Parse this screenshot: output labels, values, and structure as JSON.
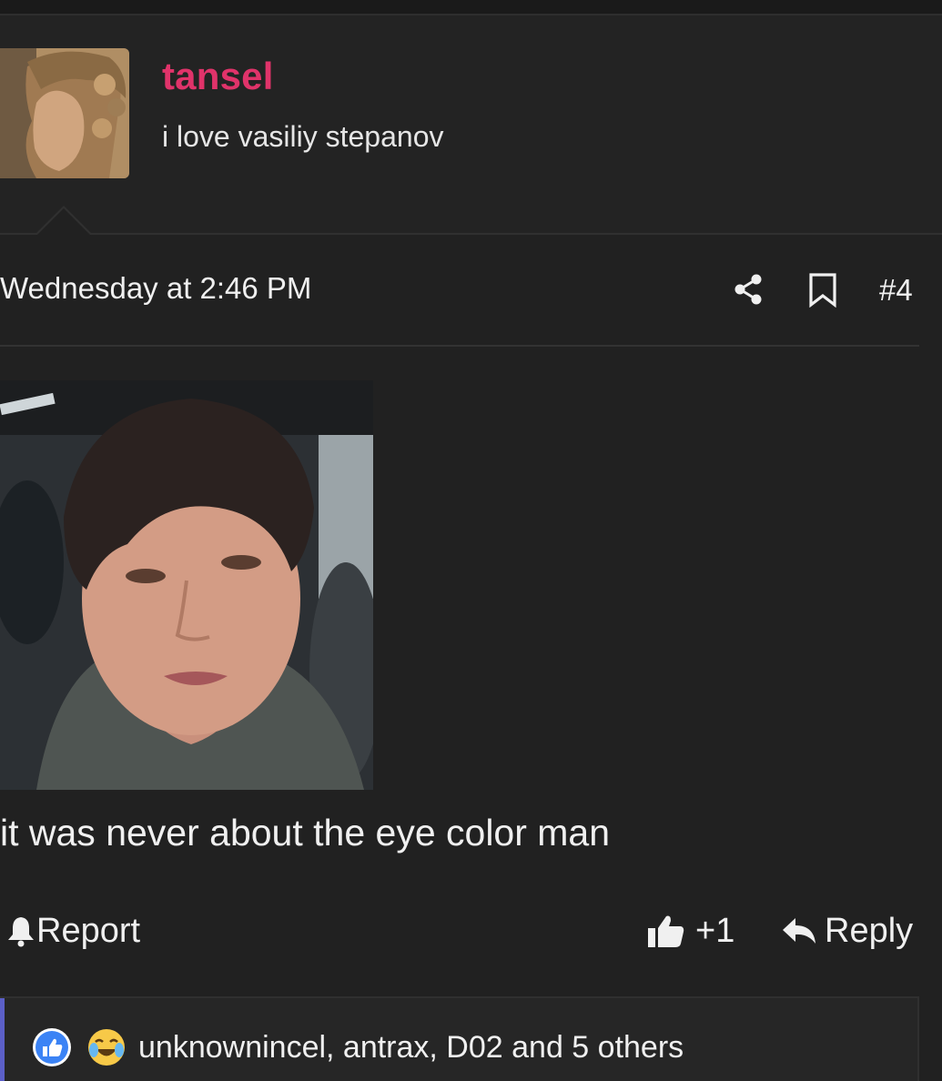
{
  "user": {
    "name": "tansel",
    "title": "i love vasiliy stepanov"
  },
  "post": {
    "date": "Wednesday at 2:46 PM",
    "number": "#4",
    "text": "it was never about the eye color man"
  },
  "actions": {
    "report_label": "Report",
    "like_label": "+1",
    "reply_label": "Reply"
  },
  "reactions": {
    "summary": "unknownincel, antrax, D02 and 5 others"
  },
  "colors": {
    "username": "#e0336a",
    "accent": "#5b5fc7",
    "background": "#212121"
  },
  "icons": [
    "share-icon",
    "bookmark-icon",
    "bell-icon",
    "thumbs-up-icon",
    "reply-arrow-icon",
    "like-reaction-icon",
    "laugh-cry-reaction-icon"
  ]
}
